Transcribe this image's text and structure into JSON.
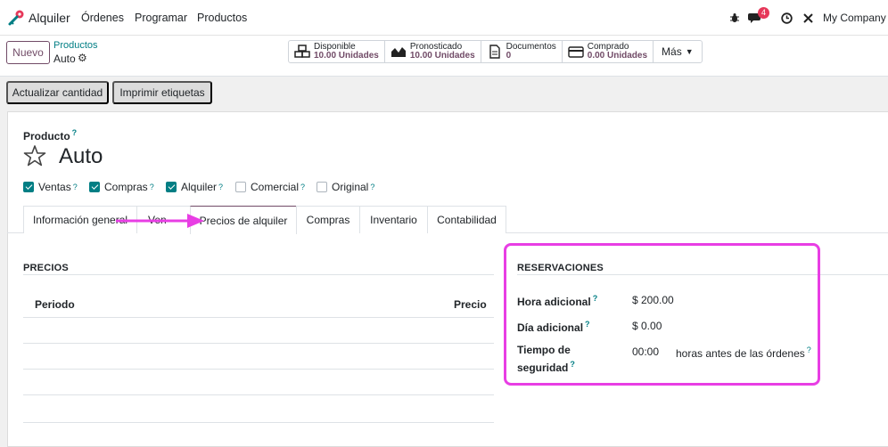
{
  "navbar": {
    "app_name": "Alquiler",
    "menu": [
      "Órdenes",
      "Programar",
      "Productos"
    ],
    "messages_badge": "4",
    "company": "My Company"
  },
  "breadcrumb": {
    "parent": "Productos",
    "current": "Auto"
  },
  "control_panel": {
    "new_button": "Nuevo",
    "smart_buttons": [
      {
        "label": "Disponible",
        "value": "10.00 Unidades",
        "icon": "boxes-icon"
      },
      {
        "label": "Pronosticado",
        "value": "10.00 Unidades",
        "icon": "area-chart-icon"
      },
      {
        "label": "Documentos",
        "value": "0",
        "icon": "document-icon"
      },
      {
        "label": "Comprado",
        "value": "0.00 Unidades",
        "icon": "credit-card-icon"
      }
    ],
    "more_button": "Más"
  },
  "actions": {
    "update_qty": "Actualizar cantidad",
    "print_labels": "Imprimir etiquetas"
  },
  "form": {
    "product_label": "Producto",
    "help_mark": "?",
    "name": "Auto",
    "options": [
      {
        "label": "Ventas",
        "checked": true
      },
      {
        "label": "Compras",
        "checked": true
      },
      {
        "label": "Alquiler",
        "checked": true
      },
      {
        "label": "Comercial",
        "checked": false
      },
      {
        "label": "Original",
        "checked": false
      }
    ],
    "tabs": [
      "Información general",
      "Ven",
      "Precios de alquiler",
      "Compras",
      "Inventario",
      "Contabilidad"
    ],
    "active_tab": "Precios de alquiler"
  },
  "pricing": {
    "title": "PRECIOS",
    "columns": [
      "Periodo",
      "Precio"
    ],
    "rows": [
      {},
      {},
      {},
      {}
    ]
  },
  "reservations": {
    "title": "RESERVACIONES",
    "extra_hour_label": "Hora adicional",
    "extra_hour_value": "$ 200.00",
    "extra_day_label": "Día adicional",
    "extra_day_value": "$ 0.00",
    "security_label_1": "Tiempo de",
    "security_label_2": "seguridad",
    "security_value": "00:00",
    "security_suffix": "horas antes de las órdenes"
  },
  "colors": {
    "brand": "#714b67",
    "accent": "#017e84",
    "highlight": "#e83ee4",
    "badge": "#e6385a"
  }
}
